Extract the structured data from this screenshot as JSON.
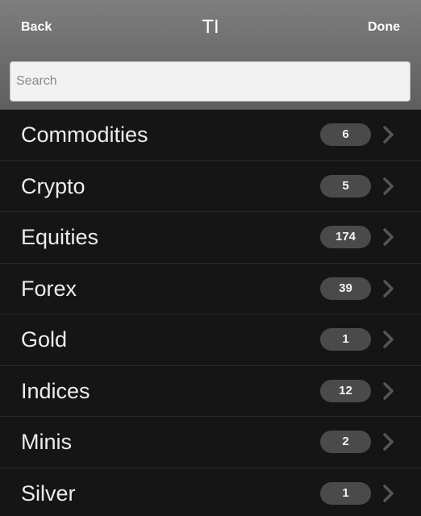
{
  "header": {
    "back_label": "Back",
    "title": "TI",
    "done_label": "Done"
  },
  "search": {
    "placeholder": "Search",
    "value": ""
  },
  "categories": [
    {
      "label": "Commodities",
      "count": "6",
      "icon": "chevron-right-icon"
    },
    {
      "label": "Crypto",
      "count": "5",
      "icon": "chevron-right-icon"
    },
    {
      "label": "Equities",
      "count": "174",
      "icon": "chevron-right-icon"
    },
    {
      "label": "Forex",
      "count": "39",
      "icon": "chevron-right-icon"
    },
    {
      "label": "Gold",
      "count": "1",
      "icon": "chevron-right-icon"
    },
    {
      "label": "Indices",
      "count": "12",
      "icon": "chevron-right-icon"
    },
    {
      "label": "Minis",
      "count": "2",
      "icon": "chevron-right-icon"
    },
    {
      "label": "Silver",
      "count": "1",
      "icon": "chevron-right-icon"
    }
  ],
  "colors": {
    "header_top": "#7e7e7e",
    "header_bottom": "#5f5f5f",
    "list_background": "#151515",
    "badge_background": "#4a4a4a",
    "text": "#ececec"
  }
}
